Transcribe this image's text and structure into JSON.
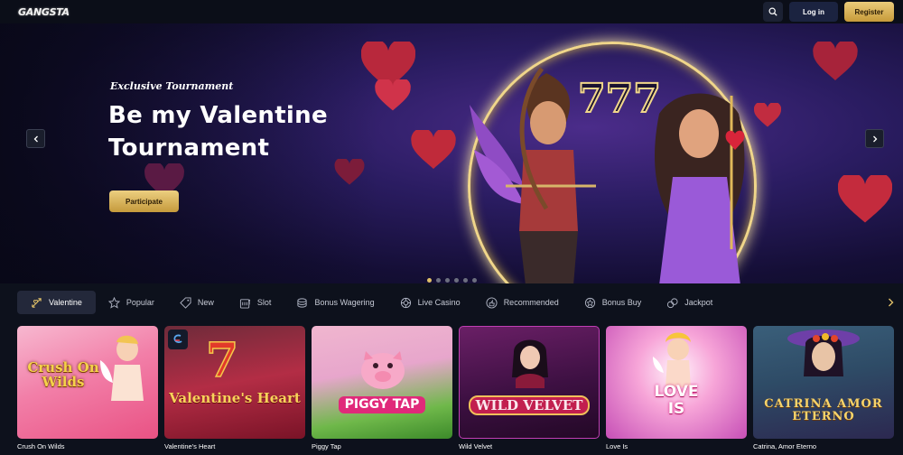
{
  "header": {
    "logo_text": "GANGSTA",
    "login_label": "Log in",
    "register_label": "Register",
    "search_icon": "search-icon",
    "colors": {
      "register_gold": "#d8b35a",
      "login_navy": "#1b2340"
    }
  },
  "hero": {
    "eyebrow": "Exclusive Tournament",
    "title": "Be my Valentine Tournament",
    "cta_label": "Participate",
    "slide_count": 6,
    "active_slide": 1,
    "prev_icon": "chevron-left-icon",
    "next_icon": "chevron-right-icon"
  },
  "categories": [
    {
      "label": "Valentine",
      "icon": "cupid-arrow-icon",
      "active": true
    },
    {
      "label": "Popular",
      "icon": "star-icon",
      "active": false
    },
    {
      "label": "New",
      "icon": "tag-icon",
      "active": false
    },
    {
      "label": "Slot",
      "icon": "slot-machine-icon",
      "active": false
    },
    {
      "label": "Bonus Wagering",
      "icon": "coins-icon",
      "active": false
    },
    {
      "label": "Live Casino",
      "icon": "roulette-icon",
      "active": false
    },
    {
      "label": "Recommended",
      "icon": "thumbs-up-icon",
      "active": false
    },
    {
      "label": "Bonus Buy",
      "icon": "bonus-coin-icon",
      "active": false
    },
    {
      "label": "Jackpot",
      "icon": "jackpot-icon",
      "active": false
    }
  ],
  "games": [
    {
      "name": "Crush On Wilds",
      "art_text": "Crush On Wilds"
    },
    {
      "name": "Valentine's Heart",
      "art_text": "Valentine's Heart"
    },
    {
      "name": "Piggy Tap",
      "art_text": "PIGGY TAP"
    },
    {
      "name": "Wild Velvet",
      "art_text": "WILD VELVET"
    },
    {
      "name": "Love Is",
      "art_text": "LOVE IS"
    },
    {
      "name": "Catrina, Amor Eterno",
      "art_text": "CATRINA AMOR ETERNO"
    }
  ]
}
